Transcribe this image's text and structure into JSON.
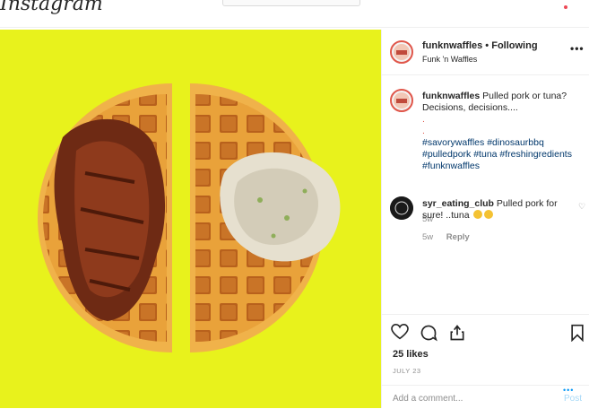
{
  "topbar": {
    "logo_text": "Instagram"
  },
  "post": {
    "author": "funknwaffles",
    "separator": "•",
    "follow_status": "Following",
    "subtitle": "Funk 'n Waffles",
    "more_icon": "more-dots-icon",
    "caption": {
      "text": "Pulled pork or tuna? Decisions, decisions....",
      "dots": [
        ".",
        "."
      ],
      "hashtags": [
        "#savorywaffles",
        "#dinosaurbbq",
        "#pulledpork",
        "#tuna",
        "#freshingredients",
        "#funknwaffles"
      ],
      "age": "5w"
    },
    "comments": [
      {
        "user": "syr_eating_club",
        "text": "Pulled pork for sure! ..tuna",
        "age": "5w",
        "reply_label": "Reply"
      }
    ],
    "likes": "25 likes",
    "date": "JULY 23",
    "add_comment_placeholder": "Add a comment...",
    "post_label": "Post",
    "loading_dots": "•••"
  },
  "colors": {
    "photo_background": "#e8f21c",
    "avatar_ring": "#e0564a",
    "link": "#00376b",
    "post_disabled": "#a7d9f7"
  }
}
